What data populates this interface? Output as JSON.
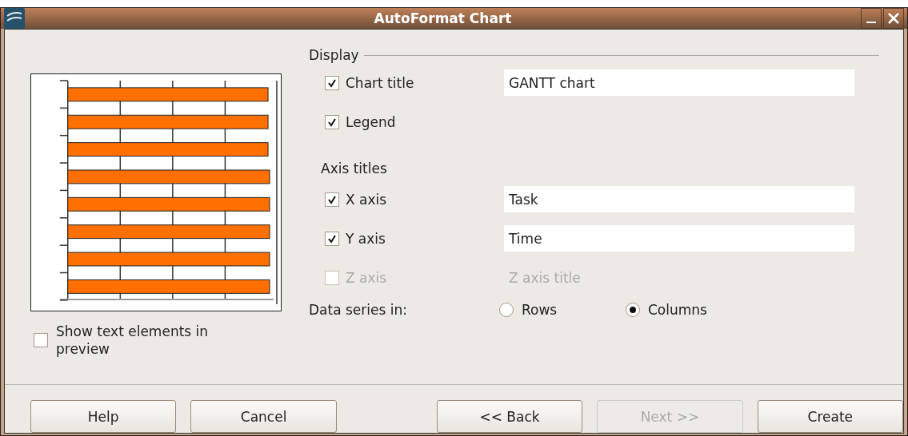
{
  "window": {
    "title": "AutoFormat Chart"
  },
  "preview_option": {
    "label": "Show text elements in preview",
    "checked": false
  },
  "display": {
    "heading": "Display",
    "options": [
      {
        "label": "Chart title",
        "checked": true,
        "disabled": false,
        "value": "GANTT chart"
      },
      {
        "label": "Legend",
        "checked": true,
        "disabled": false
      }
    ]
  },
  "axis_titles": {
    "heading": "Axis titles",
    "options": [
      {
        "label": "X axis",
        "checked": true,
        "disabled": false,
        "value": "Task"
      },
      {
        "label": "Y axis",
        "checked": true,
        "disabled": false,
        "value": "Time"
      },
      {
        "label": "Z axis",
        "checked": false,
        "disabled": true,
        "placeholder": "Z axis title"
      }
    ]
  },
  "data_series": {
    "label": "Data series in:",
    "options": [
      {
        "label": "Rows",
        "selected": false
      },
      {
        "label": "Columns",
        "selected": true
      }
    ]
  },
  "buttons": [
    {
      "label": "Help",
      "disabled": false
    },
    {
      "label": "Cancel",
      "disabled": false
    },
    {
      "label": "<< Back",
      "disabled": false
    },
    {
      "label": "Next >>",
      "disabled": true
    },
    {
      "label": "Create",
      "disabled": false
    }
  ]
}
